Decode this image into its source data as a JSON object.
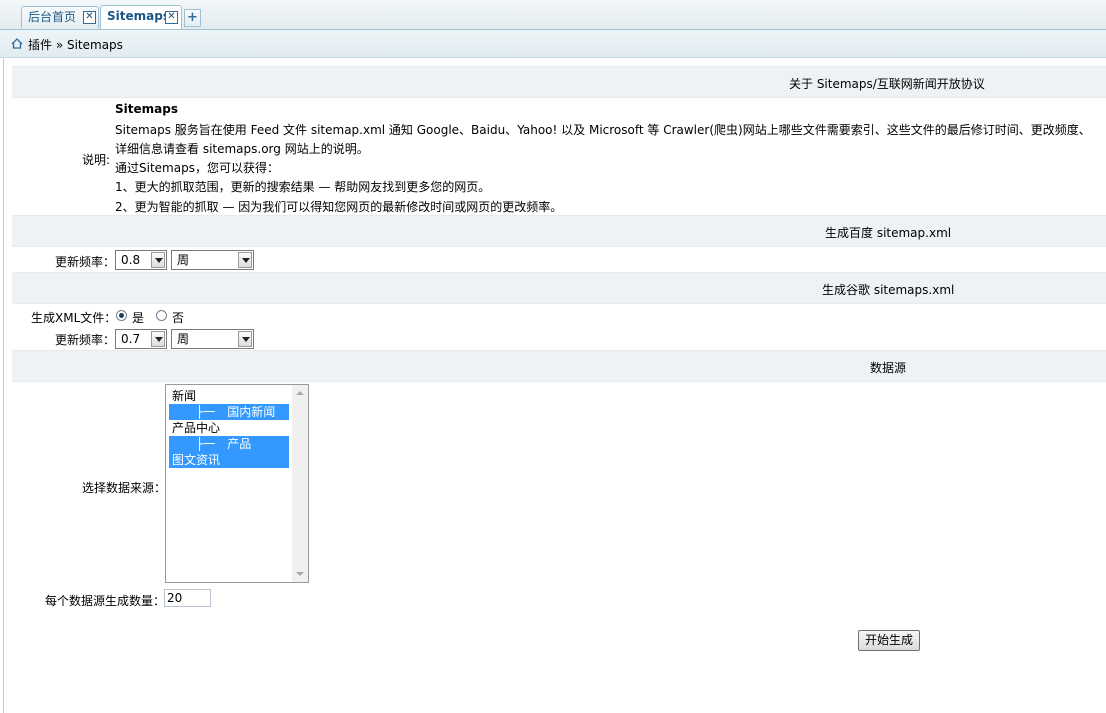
{
  "tabs": [
    {
      "label": "后台首页",
      "active": false
    },
    {
      "label": "Sitemaps",
      "active": true
    }
  ],
  "tab_close_glyph": "✕",
  "tab_add_glyph": "+",
  "breadcrumb": "插件 » Sitemaps",
  "sections": {
    "about": "关于 Sitemaps/互联网新闻开放协议",
    "baidu": "生成百度 sitemap.xml",
    "google": "生成谷歌 sitemaps.xml",
    "datasource": "数据源"
  },
  "description": {
    "label": "说明:",
    "title": "Sitemaps",
    "line1": "Sitemaps 服务旨在使用 Feed 文件 sitemap.xml 通知 Google、Baidu、Yahoo! 以及 Microsoft 等 Crawler(爬虫)网站上哪些文件需要索引、这些文件的最后修订时间、更改频度、",
    "line2": "详细信息请查看 sitemaps.org 网站上的说明。",
    "line3": "通过Sitemaps，您可以获得：",
    "line4": "1、更大的抓取范围，更新的搜索结果 — 帮助网友找到更多您的网页。",
    "line5": "2、更为智能的抓取 — 因为我们可以得知您网页的最新修改时间或网页的更改频率。"
  },
  "baidu": {
    "freq_label": "更新频率：",
    "priority": "0.8",
    "period": "周"
  },
  "google": {
    "xml_label": "生成XML文件：",
    "yes": "是",
    "no": "否",
    "xml_enabled": true,
    "freq_label": "更新频率：",
    "priority": "0.7",
    "period": "周"
  },
  "datasource": {
    "select_label": "选择数据来源：",
    "options": [
      {
        "text": "新闻",
        "selected": false
      },
      {
        "text": "　　├一　国内新闻",
        "selected": true
      },
      {
        "text": "产品中心",
        "selected": false
      },
      {
        "text": "　　├一　产品",
        "selected": true
      },
      {
        "text": "图文资讯",
        "selected": true
      }
    ],
    "count_label": "每个数据源生成数量：",
    "count_value": "20"
  },
  "submit_label": "开始生成",
  "colors": {
    "accent": "#1a5687",
    "selected": "#3399ff",
    "section_bg": "#eef2f4"
  }
}
